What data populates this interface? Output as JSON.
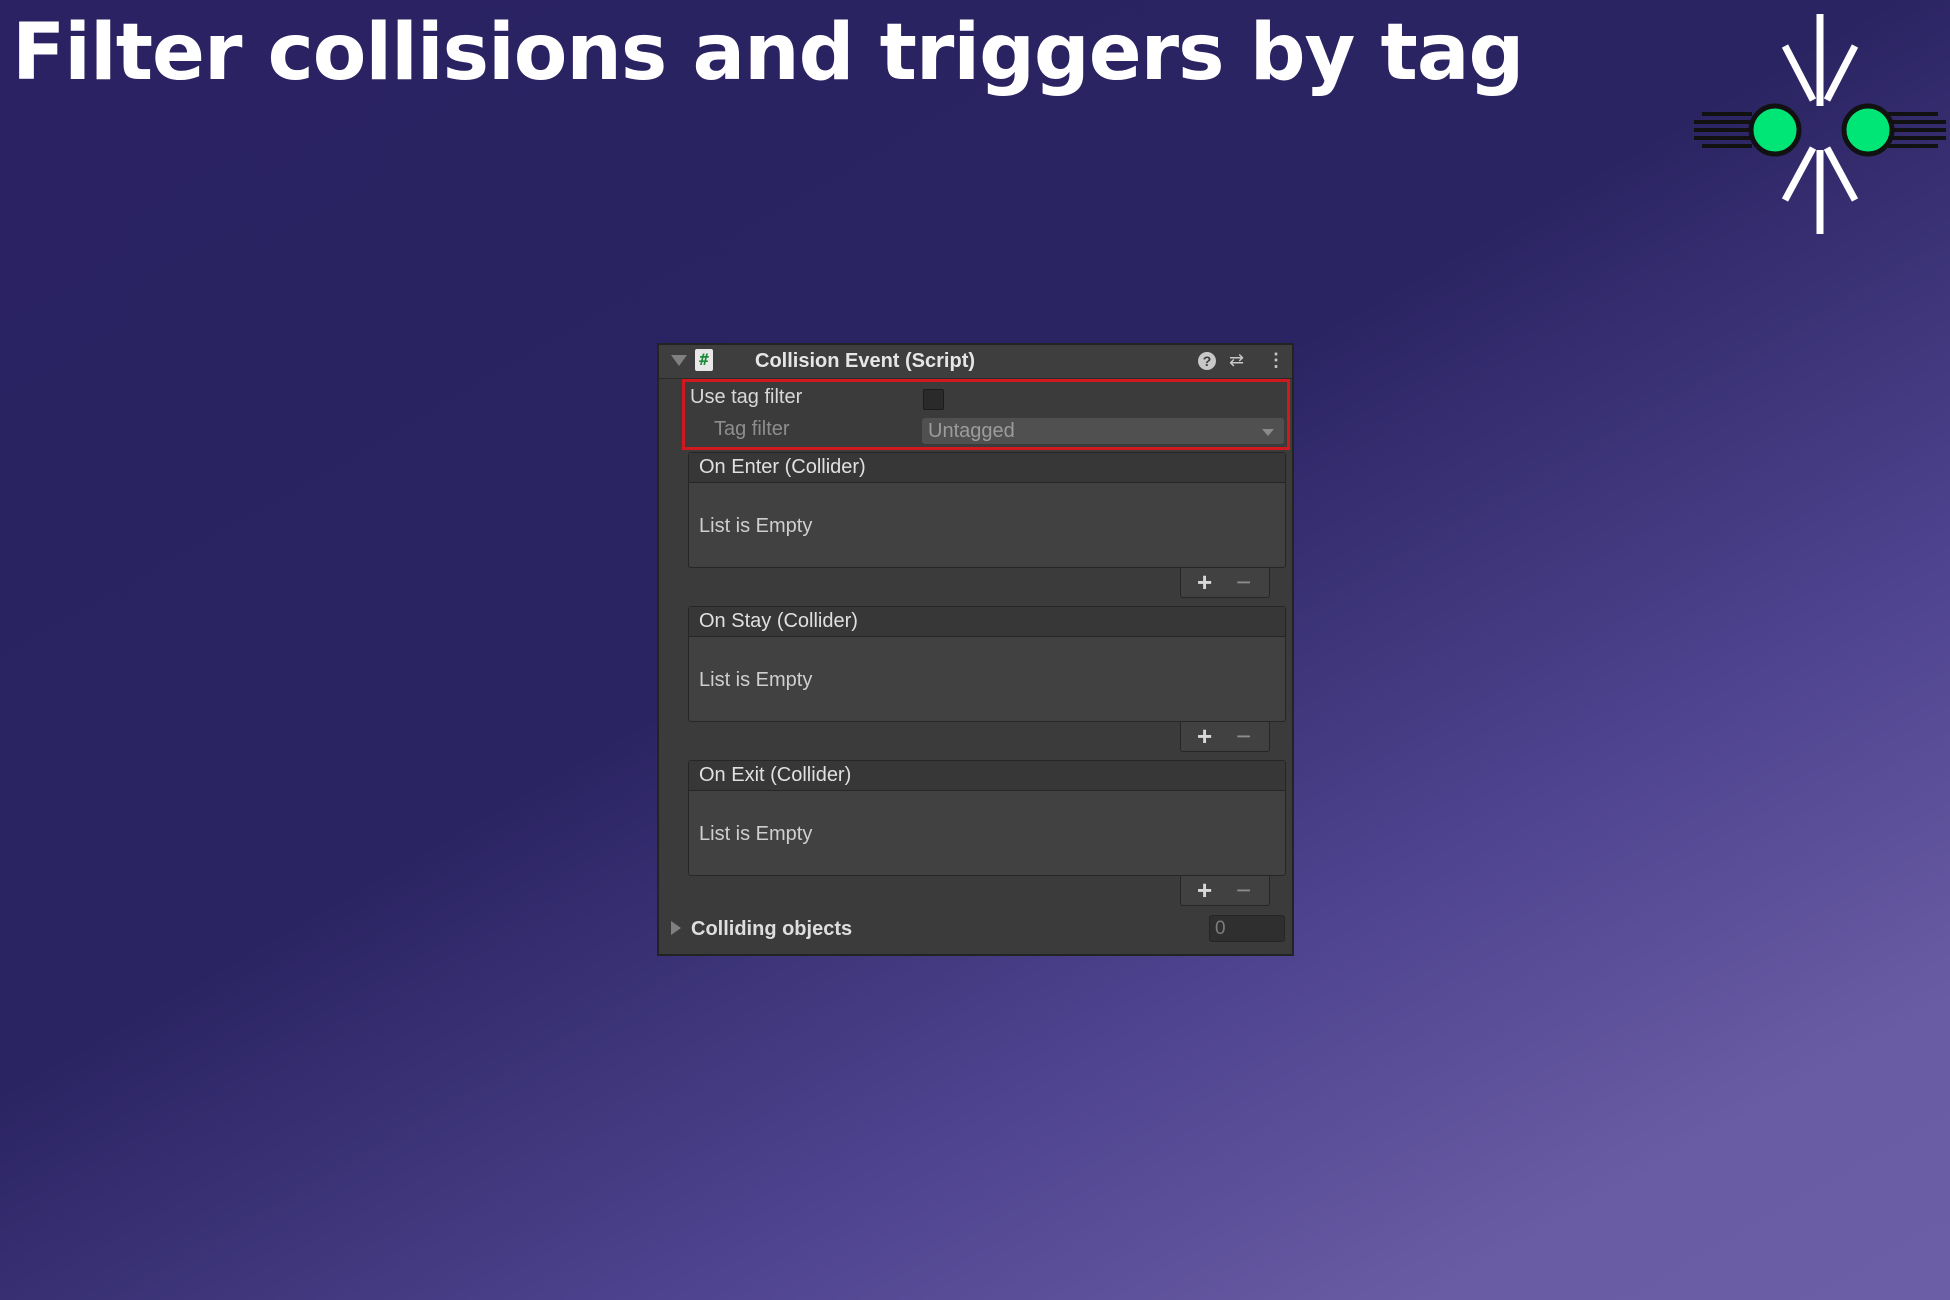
{
  "headline": "Filter collisions and triggers by tag",
  "logo": {
    "name": "collision-logo",
    "accent": "#00e676"
  },
  "inspector": {
    "component_title": "Collision Event (Script)",
    "script_icon_glyph": "#",
    "help_glyph": "?",
    "preset_glyph": "⇄",
    "menu_glyph": "⋮",
    "use_tag_filter_label": "Use tag filter",
    "use_tag_filter_checked": false,
    "tag_filter_label": "Tag filter",
    "tag_filter_value": "Untagged",
    "events": [
      {
        "title": "On Enter (Collider)",
        "empty_text": "List is Empty"
      },
      {
        "title": "On Stay (Collider)",
        "empty_text": "List is Empty"
      },
      {
        "title": "On Exit (Collider)",
        "empty_text": "List is Empty"
      }
    ],
    "plus_glyph": "+",
    "minus_glyph": "−",
    "colliding_objects_label": "Colliding objects",
    "colliding_objects_count": "0"
  },
  "colors": {
    "highlight": "#d0191f",
    "panel_bg": "#3b3b3b",
    "background_start": "#2a2262",
    "background_end": "#6b5ea6"
  }
}
